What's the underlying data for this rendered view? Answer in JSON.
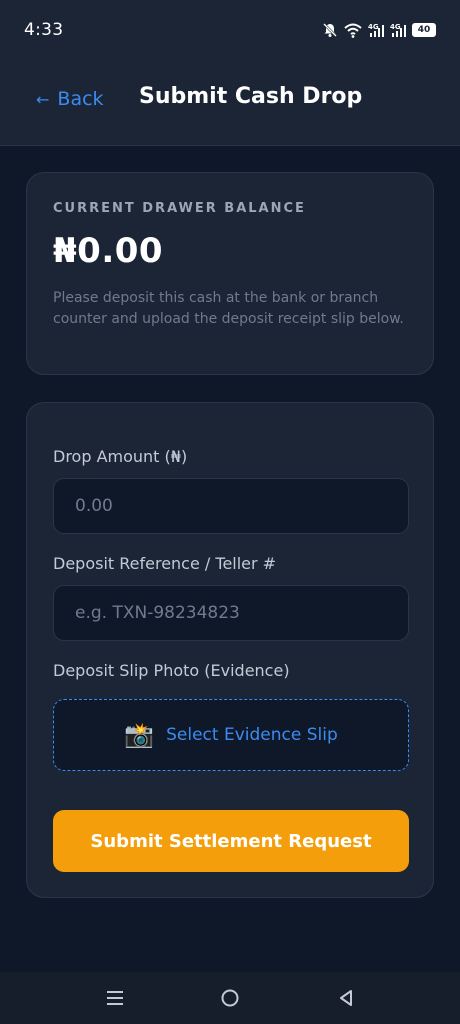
{
  "status_bar": {
    "time": "4:33",
    "network_1": "4G",
    "network_2": "4G",
    "battery": "40"
  },
  "header": {
    "back_label": "Back",
    "title": "Submit Cash Drop"
  },
  "balance_card": {
    "label": "CURRENT DRAWER BALANCE",
    "amount": "₦0.00",
    "note": "Please deposit this cash at the bank or branch counter and upload the deposit receipt slip below."
  },
  "form": {
    "amount_label": "Drop Amount (₦)",
    "amount_placeholder": "0.00",
    "reference_label": "Deposit Reference / Teller #",
    "reference_placeholder": "e.g. TXN-98234823",
    "slip_label": "Deposit Slip Photo (Evidence)",
    "upload_label": "Select Evidence Slip",
    "submit_label": "Submit Settlement Request"
  },
  "icons": {
    "mute": "bell-off-icon",
    "wifi": "wifi-icon",
    "camera": "camera-flash-icon",
    "menu": "recent-apps-icon",
    "home": "home-icon",
    "back": "back-triangle-icon"
  },
  "colors": {
    "background": "#0f1828",
    "card": "#1b2535",
    "accent": "#3b8cf0",
    "primary_button": "#f59e0b"
  }
}
